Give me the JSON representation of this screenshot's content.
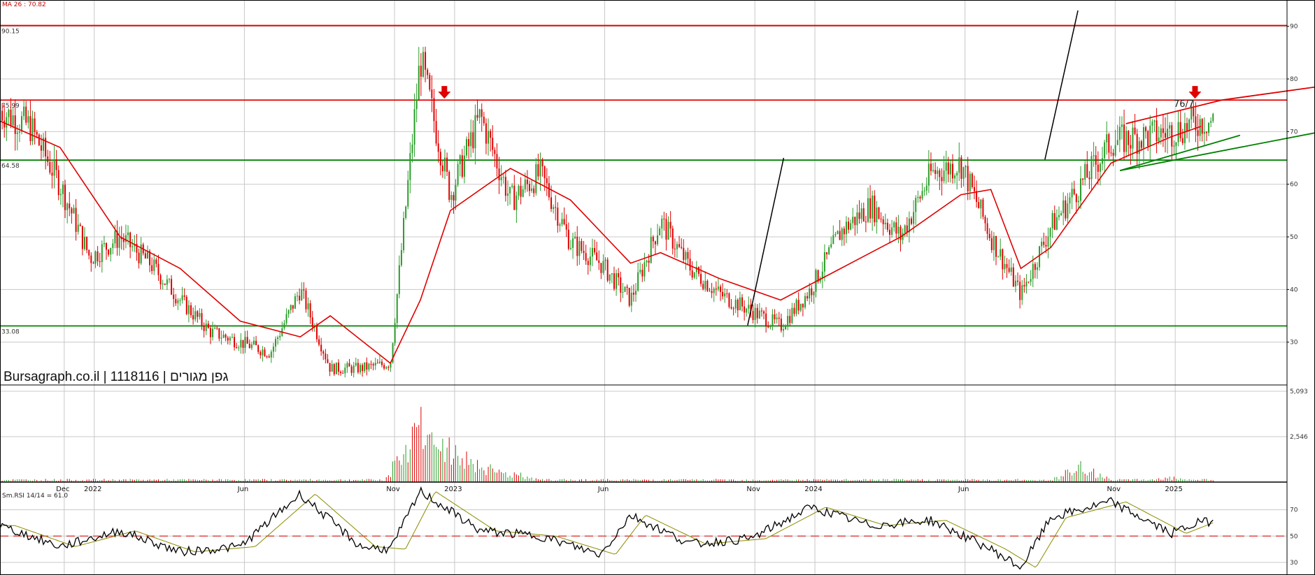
{
  "watermark": "Bursagraph.co.il | 1118116 | גפן מגורים",
  "indicators": {
    "ma_label": "MA 26 : 70.82",
    "rsi_label": "Sm.RSI 14/14 = 61.0"
  },
  "annotation": "76/7",
  "colors": {
    "up": "#2a9d2a",
    "down": "#e00000",
    "resistance": "#e00000",
    "support": "#008000",
    "ma": "#e00000",
    "rsi": "#000000",
    "rsi_signal": "#8b8b00",
    "grid": "#c8c8c8"
  },
  "chart_data": [
    {
      "type": "candlestick",
      "title": "",
      "ylim": [
        22,
        95
      ],
      "y_ticks": [
        30,
        40,
        50,
        60,
        70,
        80,
        90
      ],
      "x_ticks": [
        "Dec",
        "2022",
        "Jun",
        "Nov",
        "2023",
        "Jun",
        "Nov",
        "2024",
        "Jun",
        "Nov",
        "2025"
      ],
      "horizontal_levels": [
        {
          "label": "90.15",
          "value": 90.15,
          "color": "red"
        },
        {
          "label": "75.99",
          "value": 75.99,
          "color": "red"
        },
        {
          "label": "64.58",
          "value": 64.58,
          "color": "green"
        },
        {
          "label": "33.08",
          "value": 33.08,
          "color": "green"
        }
      ],
      "close_series": [
        {
          "x": "2021-10",
          "y": 74
        },
        {
          "x": "2021-11",
          "y": 71
        },
        {
          "x": "2021-12",
          "y": 60
        },
        {
          "x": "2022-01",
          "y": 46
        },
        {
          "x": "2022-02",
          "y": 50
        },
        {
          "x": "2022-03",
          "y": 45
        },
        {
          "x": "2022-04",
          "y": 38
        },
        {
          "x": "2022-05",
          "y": 32
        },
        {
          "x": "2022-06",
          "y": 30
        },
        {
          "x": "2022-07",
          "y": 28
        },
        {
          "x": "2022-08",
          "y": 40
        },
        {
          "x": "2022-09",
          "y": 25
        },
        {
          "x": "2022-10",
          "y": 25
        },
        {
          "x": "2022-11",
          "y": 26
        },
        {
          "x": "2022-12",
          "y": 84
        },
        {
          "x": "2023-01",
          "y": 58
        },
        {
          "x": "2023-02",
          "y": 73
        },
        {
          "x": "2023-03",
          "y": 57
        },
        {
          "x": "2023-04",
          "y": 62
        },
        {
          "x": "2023-05",
          "y": 49
        },
        {
          "x": "2023-06",
          "y": 45
        },
        {
          "x": "2023-07",
          "y": 38
        },
        {
          "x": "2023-08",
          "y": 53
        },
        {
          "x": "2023-09",
          "y": 44
        },
        {
          "x": "2023-10",
          "y": 39
        },
        {
          "x": "2023-11",
          "y": 36
        },
        {
          "x": "2023-12",
          "y": 33
        },
        {
          "x": "2024-01",
          "y": 40
        },
        {
          "x": "2024-02",
          "y": 51
        },
        {
          "x": "2024-03",
          "y": 56
        },
        {
          "x": "2024-04",
          "y": 50
        },
        {
          "x": "2024-05",
          "y": 62
        },
        {
          "x": "2024-06",
          "y": 64
        },
        {
          "x": "2024-07",
          "y": 50
        },
        {
          "x": "2024-08",
          "y": 39
        },
        {
          "x": "2024-09",
          "y": 52
        },
        {
          "x": "2024-10",
          "y": 60
        },
        {
          "x": "2024-11",
          "y": 68
        },
        {
          "x": "2024-12",
          "y": 69
        },
        {
          "x": "2025-01",
          "y": 70
        },
        {
          "x": "2025-02",
          "y": 72
        }
      ],
      "ma_series": [
        {
          "x": "2021-10",
          "y": 72
        },
        {
          "x": "2021-12",
          "y": 67
        },
        {
          "x": "2022-02",
          "y": 50
        },
        {
          "x": "2022-04",
          "y": 44
        },
        {
          "x": "2022-06",
          "y": 34
        },
        {
          "x": "2022-08",
          "y": 31
        },
        {
          "x": "2022-09",
          "y": 35
        },
        {
          "x": "2022-11",
          "y": 26
        },
        {
          "x": "2022-12",
          "y": 38
        },
        {
          "x": "2023-01",
          "y": 55
        },
        {
          "x": "2023-03",
          "y": 63
        },
        {
          "x": "2023-05",
          "y": 57
        },
        {
          "x": "2023-07",
          "y": 45
        },
        {
          "x": "2023-08",
          "y": 47
        },
        {
          "x": "2023-10",
          "y": 42
        },
        {
          "x": "2023-12",
          "y": 38
        },
        {
          "x": "2024-02",
          "y": 44
        },
        {
          "x": "2024-04",
          "y": 50
        },
        {
          "x": "2024-06",
          "y": 58
        },
        {
          "x": "2024-07",
          "y": 59
        },
        {
          "x": "2024-08",
          "y": 44
        },
        {
          "x": "2024-09",
          "y": 48
        },
        {
          "x": "2024-11",
          "y": 64
        },
        {
          "x": "2025-01",
          "y": 69
        },
        {
          "x": "2025-02",
          "y": 71
        }
      ]
    },
    {
      "type": "bar",
      "title": "",
      "ylim": [
        0,
        5093
      ],
      "y_ticks": [
        2546,
        5093
      ],
      "y_tick_labels": [
        "2,546",
        "5,093"
      ],
      "series": [
        {
          "x": "2022-12",
          "y": 5093
        },
        {
          "x": "2023-01",
          "y": 3200
        },
        {
          "x": "2023-02",
          "y": 1500
        },
        {
          "x": "2023-03",
          "y": 800
        },
        {
          "x": "2024-10",
          "y": 1200
        },
        {
          "x": "2025-01",
          "y": 400
        }
      ]
    },
    {
      "type": "line",
      "title": "",
      "ylim": [
        22,
        90
      ],
      "y_ticks": [
        30,
        50,
        70
      ],
      "reference_line": 50,
      "series": [
        {
          "x": "2021-10",
          "y": 58
        },
        {
          "x": "2021-12",
          "y": 42
        },
        {
          "x": "2022-02",
          "y": 54
        },
        {
          "x": "2022-04",
          "y": 38
        },
        {
          "x": "2022-06",
          "y": 42
        },
        {
          "x": "2022-08",
          "y": 82
        },
        {
          "x": "2022-10",
          "y": 42
        },
        {
          "x": "2022-11",
          "y": 40
        },
        {
          "x": "2022-12",
          "y": 84
        },
        {
          "x": "2023-02",
          "y": 54
        },
        {
          "x": "2023-04",
          "y": 50
        },
        {
          "x": "2023-06",
          "y": 36
        },
        {
          "x": "2023-07",
          "y": 66
        },
        {
          "x": "2023-09",
          "y": 44
        },
        {
          "x": "2023-11",
          "y": 48
        },
        {
          "x": "2024-01",
          "y": 72
        },
        {
          "x": "2024-03",
          "y": 58
        },
        {
          "x": "2024-05",
          "y": 62
        },
        {
          "x": "2024-07",
          "y": 40
        },
        {
          "x": "2024-08",
          "y": 26
        },
        {
          "x": "2024-09",
          "y": 64
        },
        {
          "x": "2024-11",
          "y": 76
        },
        {
          "x": "2025-01",
          "y": 52
        },
        {
          "x": "2025-02",
          "y": 61
        }
      ]
    }
  ]
}
